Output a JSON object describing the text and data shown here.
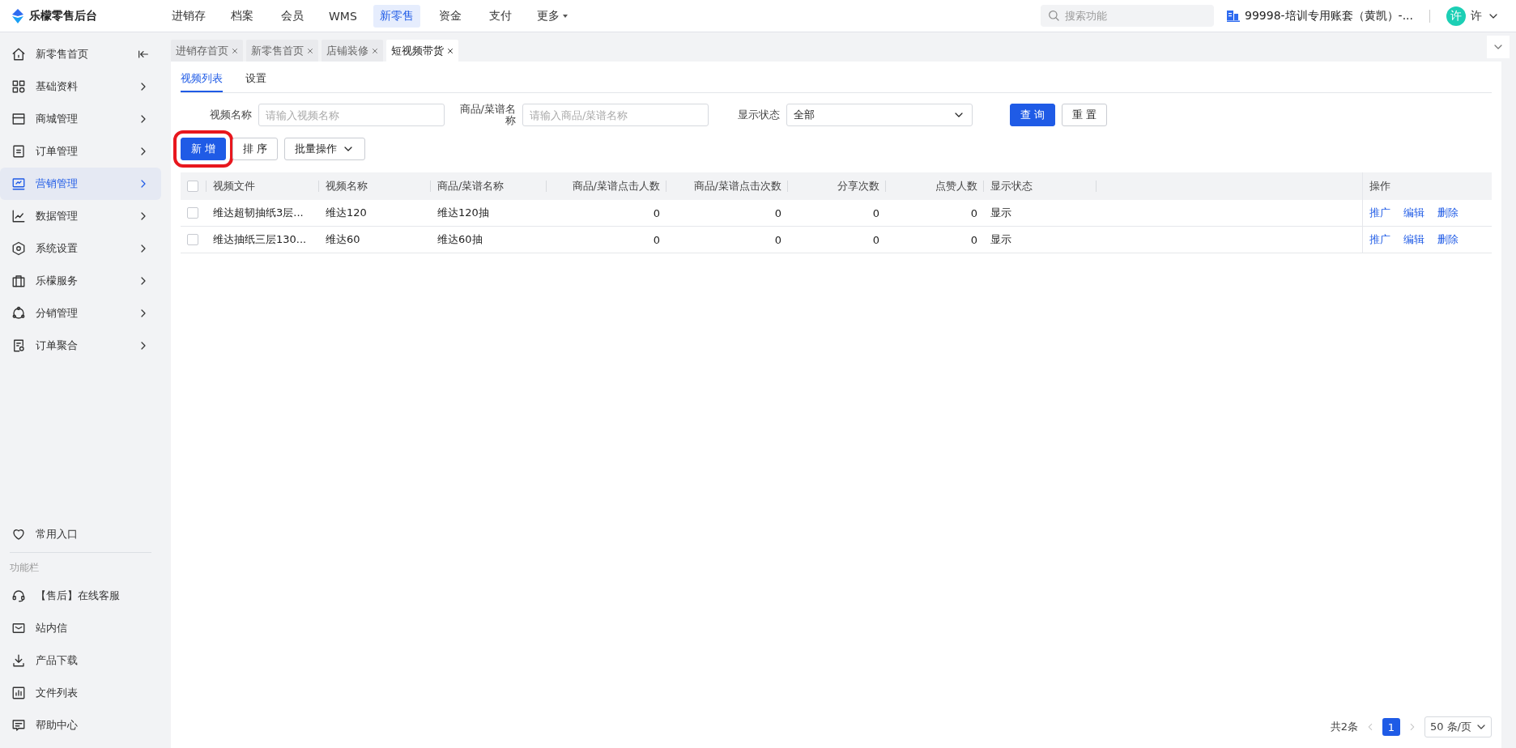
{
  "app": {
    "logo_text": "乐檬零售后台"
  },
  "top_nav": [
    {
      "label": "进销存",
      "selected": false
    },
    {
      "label": "档案",
      "selected": false
    },
    {
      "label": "会员",
      "selected": false
    },
    {
      "label": "WMS",
      "selected": false
    },
    {
      "label": "新零售",
      "selected": true
    },
    {
      "label": "资金",
      "selected": false
    },
    {
      "label": "支付",
      "selected": false
    }
  ],
  "more_menu": {
    "label": "更多"
  },
  "search": {
    "placeholder": "搜索功能"
  },
  "account": {
    "label": "99998-培训专用账套（黄凯）-..."
  },
  "user": {
    "avatar": "许",
    "name": "许"
  },
  "sidebar": {
    "items": [
      {
        "label": "新零售首页",
        "selected": false
      },
      {
        "label": "基础资料",
        "selected": false
      },
      {
        "label": "商城管理",
        "selected": false
      },
      {
        "label": "订单管理",
        "selected": false
      },
      {
        "label": "营销管理",
        "selected": true
      },
      {
        "label": "数据管理",
        "selected": false
      },
      {
        "label": "系统设置",
        "selected": false
      },
      {
        "label": "乐檬服务",
        "selected": false
      },
      {
        "label": "分销管理",
        "selected": false
      },
      {
        "label": "订单聚合",
        "selected": false
      }
    ],
    "favorites": {
      "label": "常用入口"
    },
    "section_title": "功能栏",
    "tools": [
      {
        "label": "【售后】在线客服"
      },
      {
        "label": "站内信"
      },
      {
        "label": "产品下载"
      },
      {
        "label": "文件列表"
      },
      {
        "label": "帮助中心"
      }
    ]
  },
  "page_tabs": [
    {
      "label": "进销存首页",
      "selected": false
    },
    {
      "label": "新零售首页",
      "selected": false
    },
    {
      "label": "店铺装修",
      "selected": false
    },
    {
      "label": "短视频带货",
      "selected": true
    }
  ],
  "sub_tabs": [
    {
      "label": "视频列表",
      "selected": true
    },
    {
      "label": "设置",
      "selected": false
    }
  ],
  "filters": [
    {
      "kind": "input",
      "label": "视频名称",
      "placeholder": "请输入视频名称"
    },
    {
      "kind": "input",
      "label": "商品/菜谱名称",
      "placeholder": "请输入商品/菜谱名称"
    },
    {
      "kind": "select",
      "label": "显示状态",
      "value": "全部"
    }
  ],
  "filter_buttons": [
    {
      "label": "查 询",
      "kind": "primary"
    },
    {
      "label": "重 置",
      "kind": "default"
    }
  ],
  "toolbar": [
    {
      "label": "新 增",
      "kind": "primary",
      "highlighted": true
    },
    {
      "label": "排 序",
      "kind": "default",
      "highlighted": false
    },
    {
      "label": "批量操作",
      "kind": "dropdown",
      "highlighted": false
    }
  ],
  "table": {
    "all_checked": false,
    "columns": [
      {
        "label": "视频文件",
        "kind": "text"
      },
      {
        "label": "视频名称",
        "kind": "text"
      },
      {
        "label": "商品/菜谱名称",
        "kind": "text"
      },
      {
        "label": "商品/菜谱点击人数",
        "kind": "number"
      },
      {
        "label": "商品/菜谱点击次数",
        "kind": "number"
      },
      {
        "label": "分享次数",
        "kind": "number"
      },
      {
        "label": "点赞人数",
        "kind": "number"
      },
      {
        "label": "显示状态",
        "kind": "text"
      }
    ],
    "actions_label": "操作",
    "rows": [
      {
        "checked": false,
        "cells": [
          "维达超韧抽纸3层...",
          "维达120",
          "维达120抽",
          "0",
          "0",
          "0",
          "0",
          "显示"
        ],
        "actions": [
          "推广",
          "编辑",
          "删除"
        ]
      },
      {
        "checked": false,
        "cells": [
          "维达抽纸三层130...",
          "维达60",
          "维达60抽",
          "0",
          "0",
          "0",
          "0",
          "显示"
        ],
        "actions": [
          "推广",
          "编辑",
          "删除"
        ]
      }
    ]
  },
  "pagination": {
    "total": "共2条",
    "pages": [
      {
        "label": "1",
        "selected": true
      }
    ],
    "page_size": "50 条/页"
  }
}
